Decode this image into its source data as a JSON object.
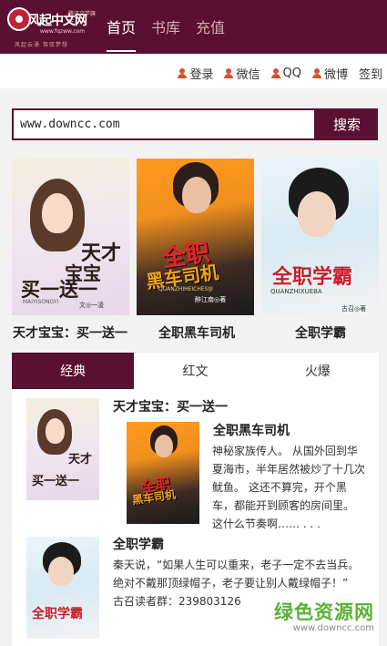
{
  "header": {
    "logo_text": "风起中文网",
    "logo_tag": "腾讯文学旗下",
    "logo_url": "www.fqzww.com",
    "logo_slogan": "风起云涌 驾驭梦想",
    "nav": [
      {
        "label": "首页",
        "active": true
      },
      {
        "label": "书库",
        "active": false
      },
      {
        "label": "充值",
        "active": false
      }
    ]
  },
  "loginbar": {
    "items": [
      {
        "label": "登录",
        "icon": "person-icon"
      },
      {
        "label": "微信",
        "icon": "person-icon"
      },
      {
        "label": "QQ",
        "icon": "person-icon"
      },
      {
        "label": "微博",
        "icon": "person-icon"
      }
    ],
    "signup": "签到"
  },
  "search": {
    "value": "www.downcc.com",
    "button": "搜索"
  },
  "featured": [
    {
      "name": "天才宝宝：买一送一",
      "cover_line1": "天才",
      "cover_line2": "宝宝",
      "cover_line3": "买一送一",
      "cover_author": "文◎一凌",
      "cover_pinyin": "MAIYISONGYI"
    },
    {
      "name": "全职黑车司机",
      "cover_line1": "全职",
      "cover_line2": "黑车司机",
      "cover_pinyin": "QUANZHIHEICHESIJI",
      "cover_author": "醉江南◎著"
    },
    {
      "name": "全职学霸",
      "cover_line1": "全职学霸",
      "cover_pinyin": "QUANZHIXUEBA",
      "cover_author": "古召◎著"
    }
  ],
  "tabs": [
    {
      "label": "经典",
      "active": true
    },
    {
      "label": "红文",
      "active": false
    },
    {
      "label": "火爆",
      "active": false
    }
  ],
  "list": [
    {
      "title": "天才宝宝：买一送一"
    },
    {
      "title": "全职黑车司机",
      "desc": [
        "神秘家族传人。 从国外回到华",
        "夏海市，半年居然被炒了十几次",
        "鱿鱼。 这还不算完，开个黑",
        "车，都能开到顾客的房间里。",
        "这什么节奏啊……   . . ."
      ]
    },
    {
      "title": "全职学霸",
      "desc": [
        "秦天说，“如果人生可以重来，老子一定不去当兵。",
        "绝对不戴那顶绿帽子，老子要让别人戴绿帽子！”",
        "古召读者群：239803126"
      ]
    }
  ],
  "watermark": {
    "main": "绿色资源网",
    "url": "www.downcc.com"
  },
  "colors": {
    "brand": "#5a1030",
    "icon_orange": "#d3542a",
    "watermark_green": "#5bb035"
  }
}
